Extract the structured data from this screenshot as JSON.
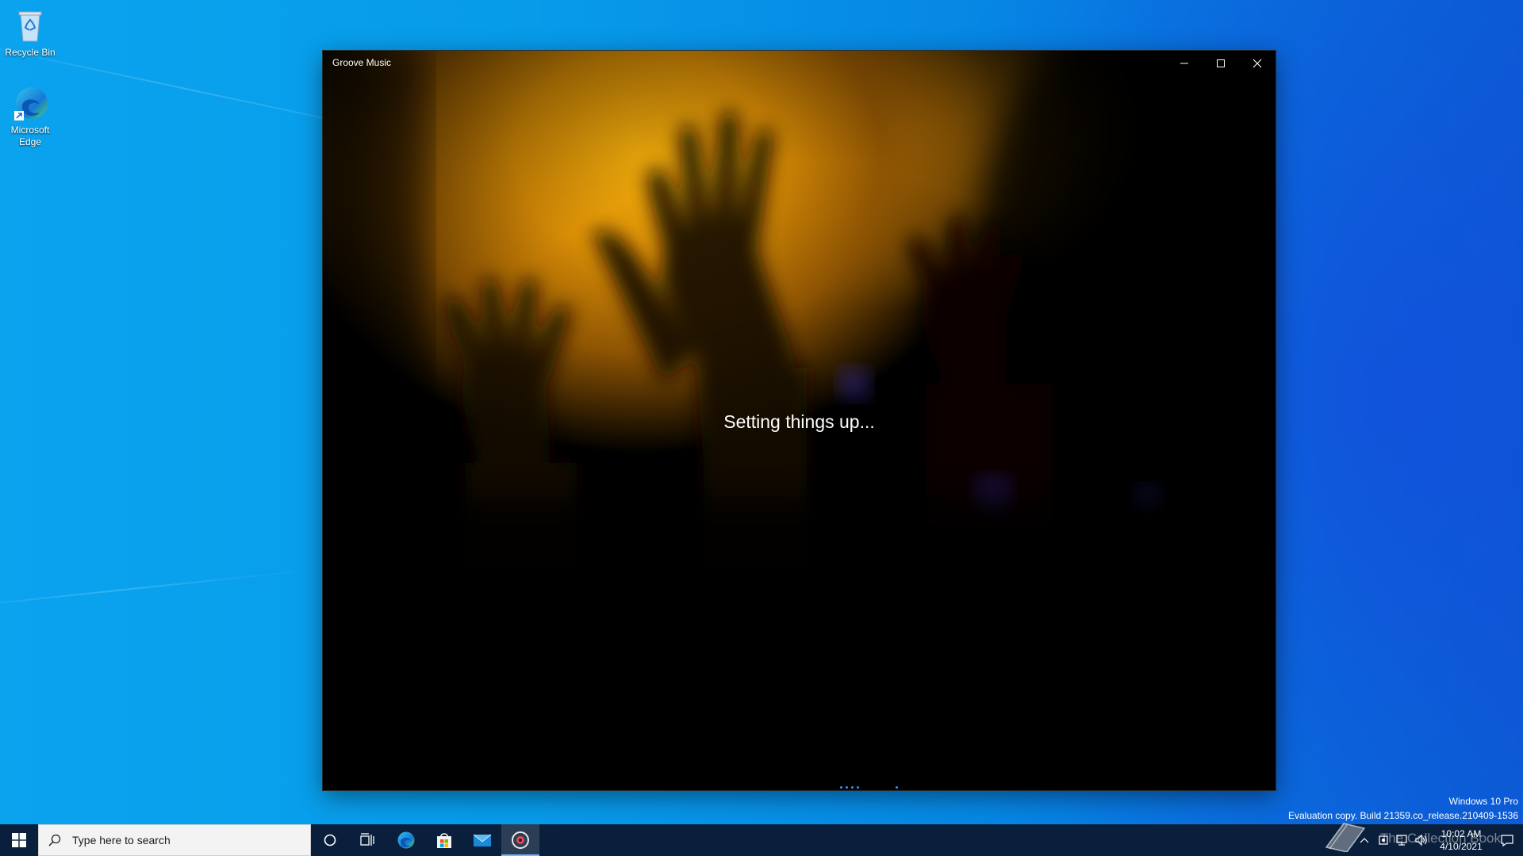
{
  "desktop": {
    "icons": [
      {
        "label": "Recycle Bin",
        "icon": "recycle-bin-icon"
      },
      {
        "label": "Microsoft Edge",
        "icon": "edge-icon"
      }
    ]
  },
  "window": {
    "title": "Groove Music",
    "status_text": "Setting things up...",
    "controls": {
      "minimize": "minimize-icon",
      "maximize": "maximize-icon",
      "close": "close-icon"
    }
  },
  "watermark": {
    "edition": "Windows 10 Pro",
    "build": "Evaluation copy. Build 21359.co_release.210409-1536"
  },
  "taskbar": {
    "search_placeholder": "Type here to search",
    "pinned": [
      {
        "name": "cortana",
        "icon": "cortana-circle-icon"
      },
      {
        "name": "task-view",
        "icon": "task-view-icon"
      },
      {
        "name": "edge",
        "icon": "edge-icon"
      },
      {
        "name": "store",
        "icon": "store-icon"
      },
      {
        "name": "mail",
        "icon": "mail-icon"
      },
      {
        "name": "groove-music",
        "icon": "groove-music-icon",
        "active": true
      }
    ],
    "tray": {
      "time": "10:02 AM",
      "date": "4/10/2021",
      "overlay_text": "The Collection Book"
    }
  },
  "colors": {
    "desktop_blue": "#0a98ea",
    "taskbar": "#0a1f3b",
    "accent": "#3b8cff",
    "hero_gold": "#e9a00b"
  }
}
